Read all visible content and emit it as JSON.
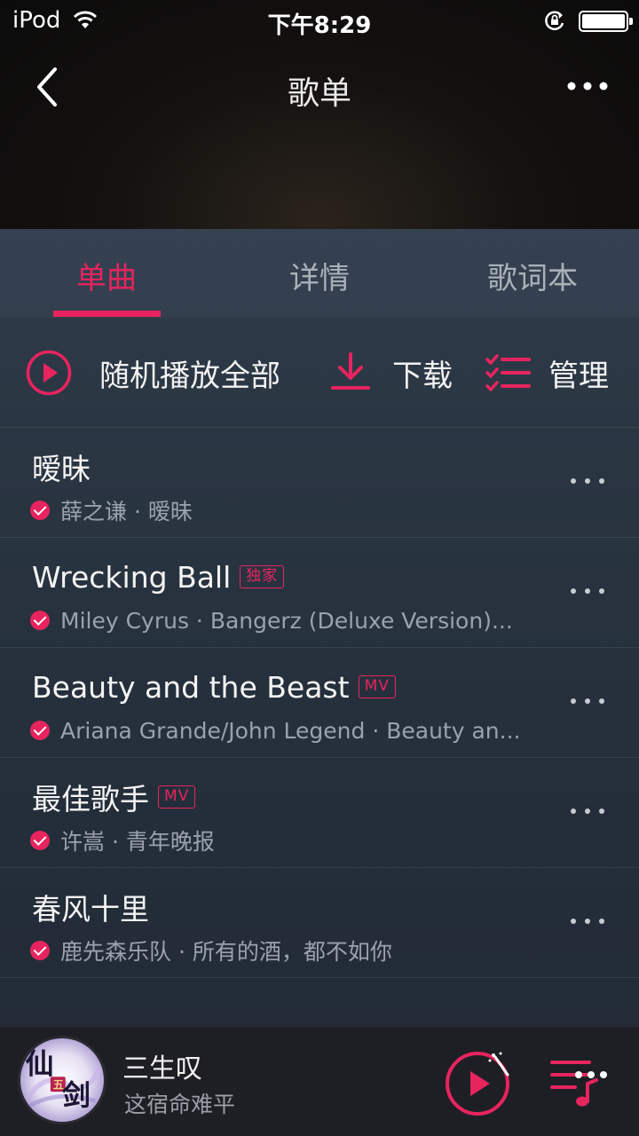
{
  "status_bar": {
    "carrier": "iPod",
    "time": "下午8:29"
  },
  "nav": {
    "title": "歌单"
  },
  "tabs": [
    {
      "label": "单曲",
      "active": true
    },
    {
      "label": "详情",
      "active": false
    },
    {
      "label": "歌词本",
      "active": false
    }
  ],
  "actions": {
    "shuffle_label": "随机播放全部",
    "download_label": "下载",
    "manage_label": "管理"
  },
  "songs": [
    {
      "title": "暧昧",
      "badge": "",
      "subtitle": "薛之谦 · 暧昧"
    },
    {
      "title": "Wrecking Ball",
      "badge": "独家",
      "subtitle": "Miley Cyrus · Bangerz (Deluxe Version)..."
    },
    {
      "title": "Beauty and the Beast",
      "badge": "MV",
      "subtitle": "Ariana Grande/John Legend · Beauty an..."
    },
    {
      "title": "最佳歌手",
      "badge": "MV",
      "subtitle": "许嵩 · 青年晚报"
    },
    {
      "title": "春风十里",
      "badge": "",
      "subtitle": "鹿先森乐队 · 所有的酒，都不如你"
    }
  ],
  "player": {
    "title": "三生叹",
    "subtitle": "这宿命难平",
    "cover_text": "仙剑"
  },
  "colors": {
    "accent": "#e8245f",
    "panel": "#2a3542",
    "player_bg": "#1e1f25"
  },
  "icons": {
    "back": "chevron-left-icon",
    "more": "more-dots-icon",
    "shuffle": "play-circle-icon",
    "download": "download-icon",
    "manage": "manage-list-icon",
    "verified": "check-circle-icon",
    "player_play": "play-circle-icon",
    "playlist": "playlist-icon"
  }
}
